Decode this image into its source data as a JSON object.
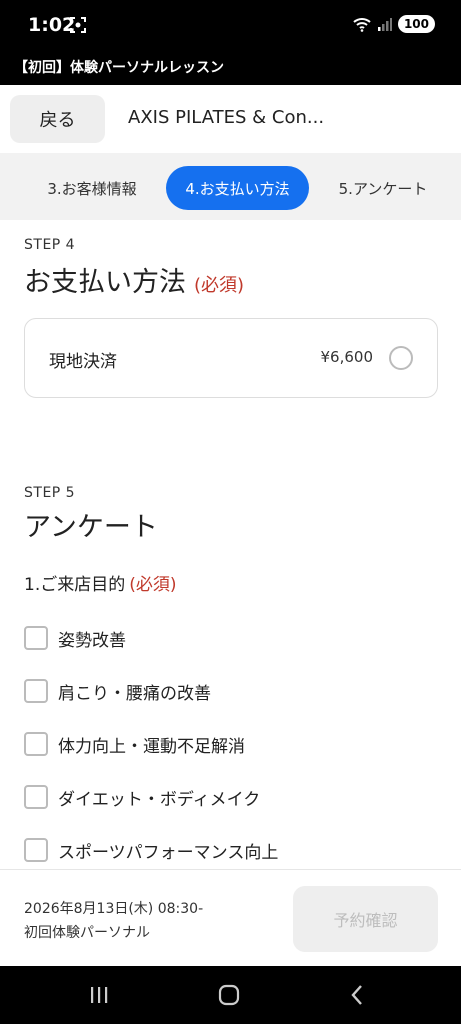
{
  "status_bar": {
    "time": "1:02",
    "battery": "100"
  },
  "app_title": "【初回】体験パーソナルレッスン",
  "nav": {
    "back_label": "戻る",
    "studio_name": "AXIS PILATES & Con..."
  },
  "step_tabs": [
    {
      "label": "3.お客様情報",
      "active": false
    },
    {
      "label": "4.お支払い方法",
      "active": true
    },
    {
      "label": "5.アンケート",
      "active": false
    }
  ],
  "step4": {
    "step_label": "STEP 4",
    "title": "お支払い方法",
    "required": "(必須)",
    "payment_option": {
      "label": "現地決済",
      "price": "¥6,600"
    }
  },
  "step5": {
    "step_label": "STEP 5",
    "title": "アンケート",
    "question": "1.ご来店目的",
    "required": "(必須)",
    "options": [
      "姿勢改善",
      "肩こり・腰痛の改善",
      "体力向上・運動不足解消",
      "ダイエット・ボディメイク",
      "スポーツパフォーマンス向上"
    ]
  },
  "bottom_bar": {
    "date": "2026年8月13日(木) 08:30-",
    "plan": "初回体験パーソナル",
    "confirm_label": "予約確認"
  },
  "colors": {
    "accent": "#1570ef",
    "required": "#c0392b"
  }
}
